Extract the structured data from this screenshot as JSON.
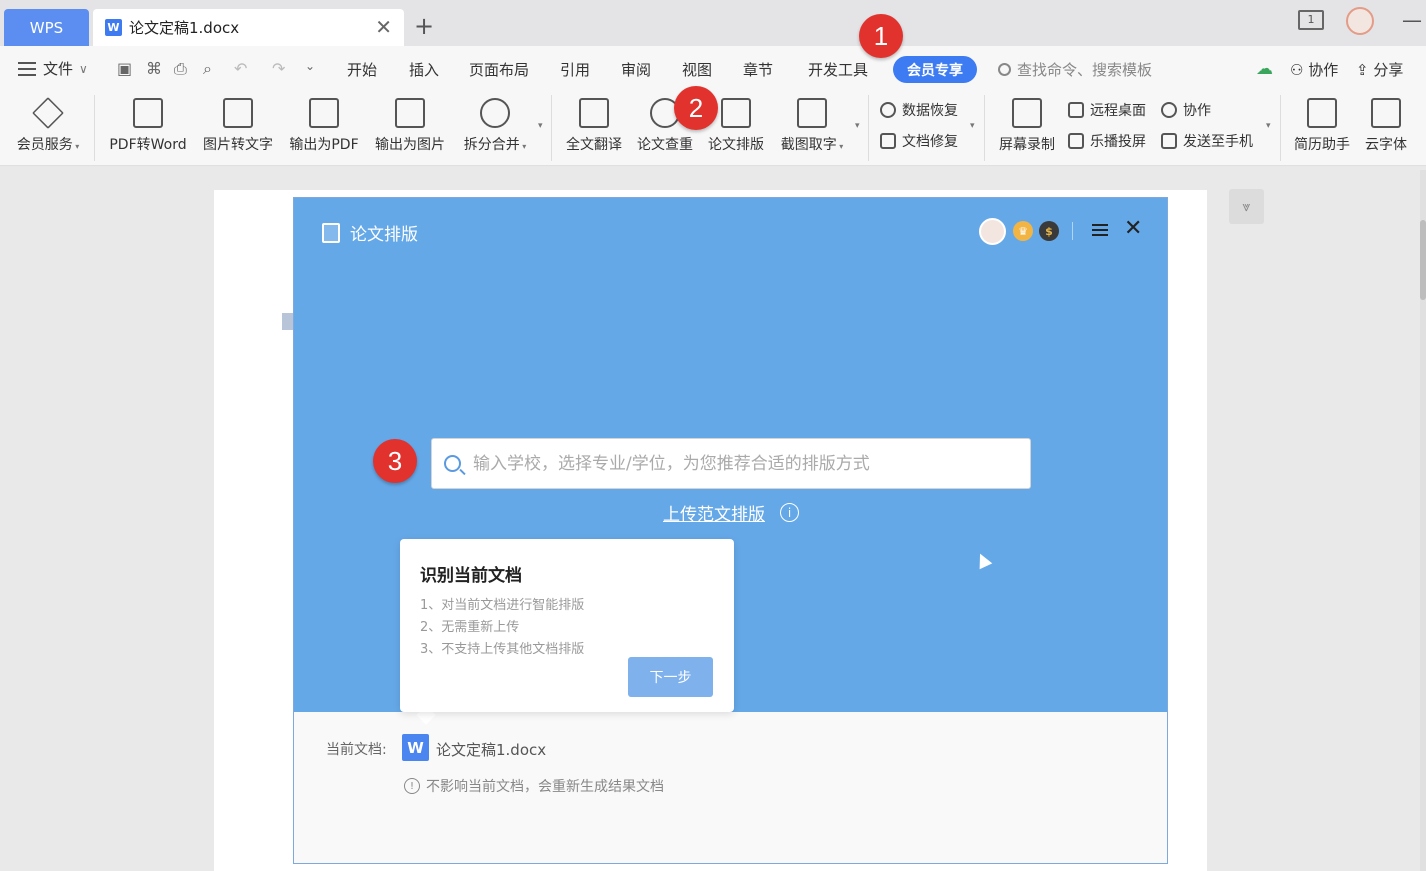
{
  "tabs": {
    "wps": "WPS",
    "doc_title": "论文定稿1.docx",
    "doc_badge": "W",
    "close": "✕",
    "new_tab": "+",
    "page_indicator": "1"
  },
  "menubar": {
    "file": "文件",
    "items": [
      "开始",
      "插入",
      "页面布局",
      "引用",
      "审阅",
      "视图",
      "章节",
      "开发工具"
    ],
    "vip": "会员专享",
    "search_placeholder": "查找命令、搜索模板",
    "collab": "协作",
    "share": "分享"
  },
  "ribbon": {
    "member_service": "会员服务",
    "pdf_to_word": "PDF转Word",
    "img_to_text": "图片转文字",
    "export_pdf": "输出为PDF",
    "export_img": "输出为图片",
    "split_merge": "拆分合并",
    "translate": "全文翻译",
    "paper_check": "论文查重",
    "paper_format": "论文排版",
    "screenshot_text": "截图取字",
    "data_recovery": "数据恢复",
    "doc_repair": "文档修复",
    "screen_record": "屏幕录制",
    "remote_desktop": "远程桌面",
    "collab": "协作",
    "cast": "乐播投屏",
    "send_phone": "发送至手机",
    "resume": "简历助手",
    "cloud_font": "云字体"
  },
  "dialog": {
    "title": "论文排版",
    "search_placeholder": "输入学校，选择专业/学位，为您推荐合适的排版方式",
    "upload_link": "上传范文排版",
    "card": {
      "title": "识别当前文档",
      "items": [
        "1、对当前文档进行智能排版",
        "2、无需重新上传",
        "3、不支持上传其他文档排版"
      ],
      "next": "下一步"
    },
    "current_doc_label": "当前文档:",
    "current_doc_name": "论文定稿1.docx",
    "notice": "不影响当前文档，会重新生成结果文档"
  },
  "badges": [
    "1",
    "2",
    "3"
  ],
  "colors": {
    "accent": "#3d7bf2",
    "dialog_header": "#65a8e8",
    "badge_red": "#e1322d"
  }
}
